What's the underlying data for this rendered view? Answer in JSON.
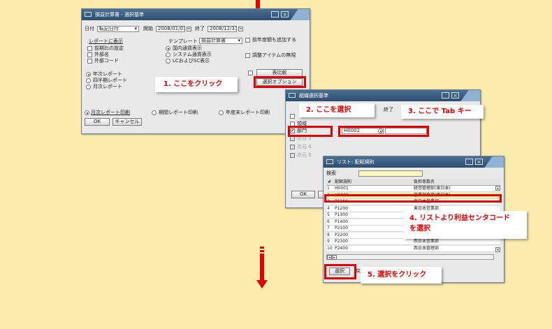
{
  "colors": {
    "background": "#fbecae",
    "accent_red": "#e00000",
    "title_bar": "#2d4e70"
  },
  "win1": {
    "title": "損益計算書 - 選択基準",
    "date_label": "日付",
    "date_type": "転記日付",
    "from_label": "開始",
    "from_value": "2008/01/01",
    "to_label": "終了",
    "to_value": "2008/12/31",
    "report_display": "レポートに表示",
    "template_label": "テンプレート",
    "template_value": "損益計算書",
    "opt_prev_period": "前期比の設定",
    "opt_foreign": "外部名",
    "opt_foreign_code": "外部コード",
    "disp_local": "国内通貨表示",
    "disp_system": "システム通貨表示",
    "disp_both": "LCおよびSC表示",
    "add_prev_year": "前年度額も追加する",
    "adjust_items": "調整アイテムの無視",
    "annual": "年次レポート",
    "quarterly": "四半期レポート",
    "monthly": "月次レポート",
    "compare_label": "表比較",
    "select_options_label": "選択オプション",
    "print_monthly": "月次レポート印刷",
    "print_period": "期間レポート印刷",
    "print_yearend": "年度末レポート印刷",
    "ok": "OK",
    "cancel": "キャンセル"
  },
  "win2": {
    "title": "組織選択基準",
    "to_col": "終了",
    "dim1": "領域",
    "dim2": "部門",
    "dim2_value": "H0002",
    "dim3": "次元 3",
    "dim4": "次元 4",
    "dim5": "次元 5",
    "ok": "OK"
  },
  "win3": {
    "title": "リスト: 配賦規則",
    "search_label": "検索",
    "col_rule": "配賦規則",
    "col_name": "負担係数名",
    "rows": [
      {
        "n": "1",
        "code": "H0001",
        "name": "経営管理部(東日本)"
      },
      {
        "n": "2",
        "code": "H0002",
        "name": "営業部東京(東日本)"
      },
      {
        "n": "3",
        "code": "P1100",
        "name": "東日本営業部"
      },
      {
        "n": "4",
        "code": "P1200",
        "name": "東日本営業部"
      },
      {
        "n": "5",
        "code": "P1300",
        "name": ""
      },
      {
        "n": "6",
        "code": "P1400",
        "name": ""
      },
      {
        "n": "7",
        "code": "P2100",
        "name": ""
      },
      {
        "n": "8",
        "code": "P2200",
        "name": ""
      },
      {
        "n": "9",
        "code": "P2300",
        "name": "西日本営業部"
      },
      {
        "n": "10",
        "code": "P2400",
        "name": "西日本管理部"
      }
    ],
    "select_button": "選択",
    "back_button": "戻"
  },
  "callouts": {
    "c1": "1. ここをクリック",
    "c2": "2. ここを選択",
    "c3": "3. ここで Tab キー",
    "c4": "4. リストより利益センタコード\nを選択",
    "c5": "5. 選択をクリック"
  }
}
